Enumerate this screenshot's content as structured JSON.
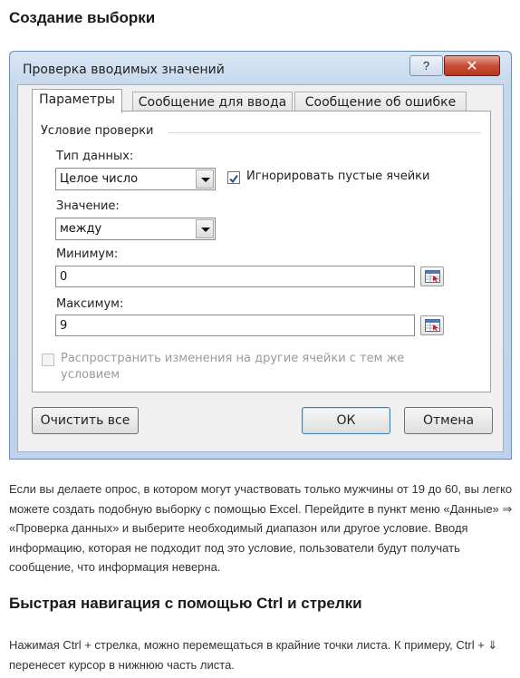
{
  "article": {
    "heading1": "Создание выборки",
    "paragraph1": "Если вы делаете опрос, в котором могут участвовать только мужчины от 19 до 60, вы легко можете создать подобную выборку с помощью Excel. Перейдите в пункт меню «Данные» ⇒ «Проверка данных» и выберите необходимый диапазон или другое условие. Вводя информацию, которая не подходит под это условие, пользователи будут получать сообщение, что информация неверна.",
    "heading2": "Быстрая навигация с помощью Ctrl и стрелки",
    "paragraph2": "Нажимая Ctrl + стрелка, можно перемещаться в крайние точки листа. К примеру, Ctrl + ⇓ перенесет курсор в нижнюю часть листа."
  },
  "dialog": {
    "title": "Проверка вводимых значений",
    "help_label": "?",
    "close_label": "✕",
    "tabs": [
      {
        "label": "Параметры",
        "active": true
      },
      {
        "label": "Сообщение для ввода",
        "active": false
      },
      {
        "label": "Сообщение об ошибке",
        "active": false
      }
    ],
    "group_label": "Условие проверки",
    "data_type_label": "Тип данных:",
    "data_type_value": "Целое число",
    "ignore_blank_label": "Игнорировать пустые ячейки",
    "ignore_blank_checked": true,
    "value_label": "Значение:",
    "value_value": "между",
    "minimum_label": "Минимум:",
    "minimum_value": "0",
    "maximum_label": "Максимум:",
    "maximum_value": "9",
    "apply_label_line1": "Распространить изменения на другие ячейки с тем же",
    "apply_label_line2": "условием",
    "clear_button": "Очистить все",
    "ok_button": "ОК",
    "cancel_button": "Отмена"
  },
  "colors": {
    "accent": "#3c7fb1",
    "close": "#c84d34",
    "check": "#1f4e9a"
  }
}
